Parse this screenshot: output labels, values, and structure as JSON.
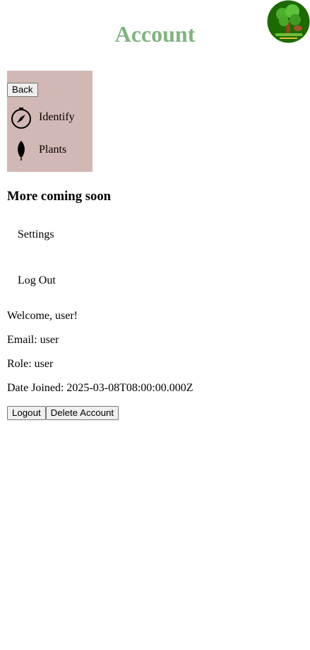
{
  "header": {
    "title": "Account"
  },
  "sidebar": {
    "back_label": "Back",
    "items": [
      {
        "label": "Identify",
        "icon": "compass-icon"
      },
      {
        "label": "Plants",
        "icon": "leaf-icon"
      }
    ],
    "background": "#d2b8b4"
  },
  "menu": {
    "heading": "More coming soon",
    "settings_label": "Settings",
    "logout_label": "Log Out"
  },
  "profile": {
    "welcome": "Welcome, user!",
    "email": "Email: user",
    "role": "Role: user",
    "date_joined": "Date Joined: 2025-03-08T08:00:00.000Z"
  },
  "actions": {
    "logout_label": "Logout",
    "delete_label": "Delete Account"
  },
  "colors": {
    "title": "#7fb47e",
    "logo_bg": "#1c6a00"
  }
}
